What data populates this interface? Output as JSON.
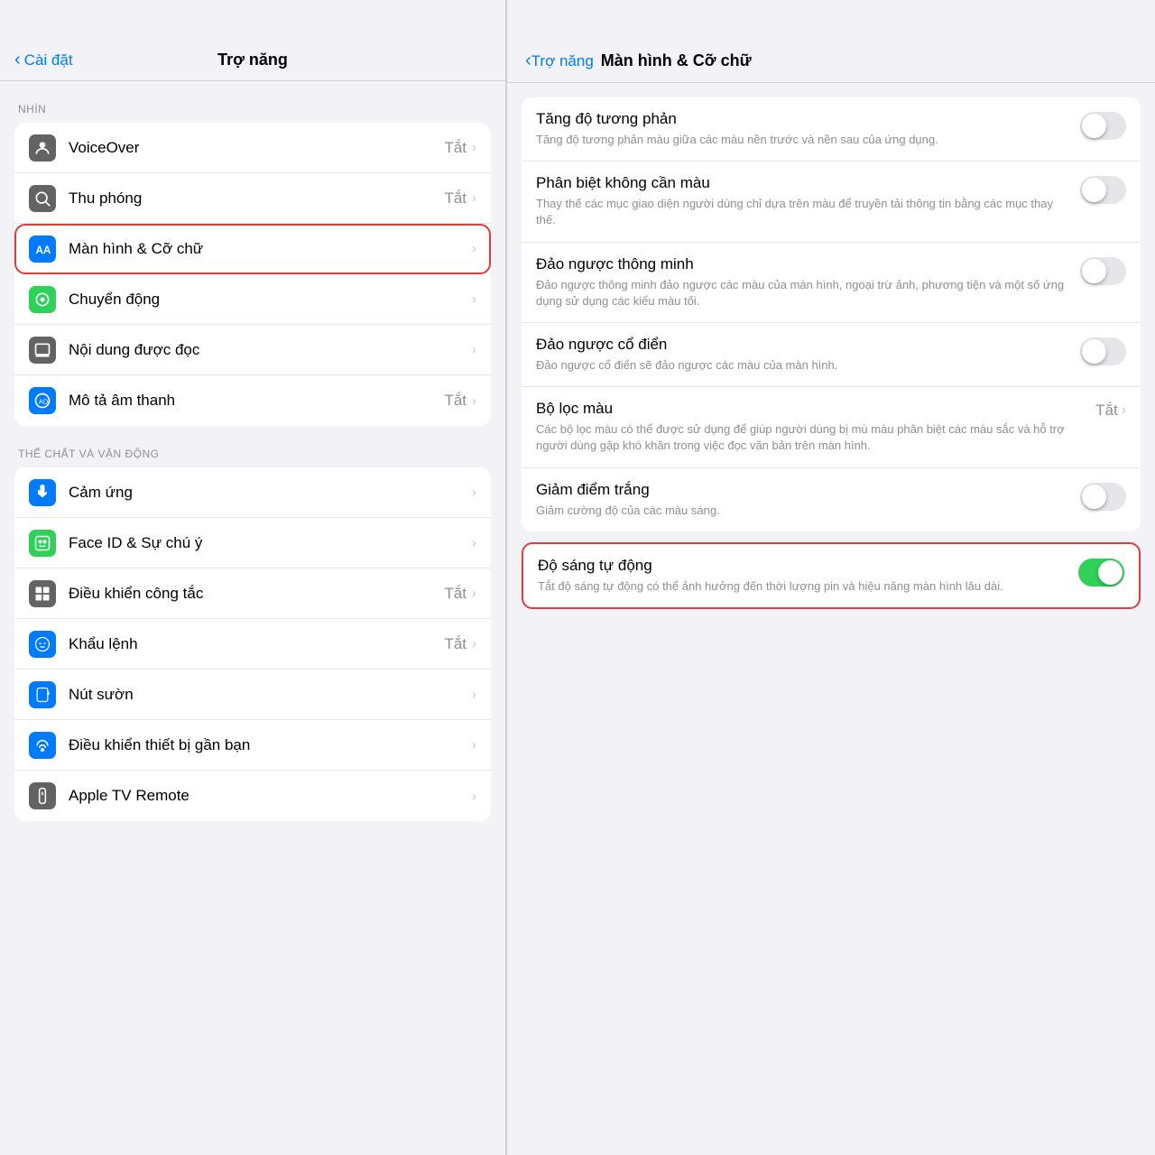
{
  "left": {
    "back_label": "Cài đặt",
    "title": "Trợ năng",
    "sections": [
      {
        "label": "NHÌN",
        "items": [
          {
            "id": "voiceover",
            "label": "VoiceOver",
            "value": "Tắt",
            "icon_bg": "icon-voiceover",
            "icon": "voiceover"
          },
          {
            "id": "zoom",
            "label": "Thu phóng",
            "value": "Tắt",
            "icon_bg": "icon-zoom",
            "icon": "zoom"
          },
          {
            "id": "display",
            "label": "Màn hình & Cỡ chữ",
            "value": "",
            "icon_bg": "icon-display",
            "icon": "display",
            "selected": true
          },
          {
            "id": "motion",
            "label": "Chuyển động",
            "value": "",
            "icon_bg": "icon-motion",
            "icon": "motion"
          },
          {
            "id": "spoken",
            "label": "Nội dung được đọc",
            "value": "",
            "icon_bg": "icon-spoken",
            "icon": "spoken"
          },
          {
            "id": "audiodesc",
            "label": "Mô tả âm thanh",
            "value": "Tắt",
            "icon_bg": "icon-audiodesc",
            "icon": "audiodesc"
          }
        ]
      },
      {
        "label": "THỂ CHẤT VÀ VẬN ĐỘNG",
        "items": [
          {
            "id": "touch",
            "label": "Cảm ứng",
            "value": "",
            "icon_bg": "icon-touch",
            "icon": "touch"
          },
          {
            "id": "faceid",
            "label": "Face ID & Sự chú ý",
            "value": "",
            "icon_bg": "icon-faceid",
            "icon": "faceid"
          },
          {
            "id": "switch",
            "label": "Điều khiển công tắc",
            "value": "Tắt",
            "icon_bg": "icon-switch",
            "icon": "switch"
          },
          {
            "id": "voice",
            "label": "Khẩu lệnh",
            "value": "Tắt",
            "icon_bg": "icon-voice",
            "icon": "voice"
          },
          {
            "id": "sidebutton",
            "label": "Nút sườn",
            "value": "",
            "icon_bg": "icon-sidebutton",
            "icon": "sidebutton"
          },
          {
            "id": "nearby",
            "label": "Điều khiển thiết bị gần bạn",
            "value": "",
            "icon_bg": "icon-nearby",
            "icon": "nearby"
          },
          {
            "id": "appletv",
            "label": "Apple TV Remote",
            "value": "",
            "icon_bg": "icon-appletv",
            "icon": "appletv"
          }
        ]
      }
    ]
  },
  "right": {
    "back_label": "Trợ năng",
    "title": "Màn hình & Cỡ chữ",
    "items": [
      {
        "id": "contrast",
        "title": "Tăng độ tương phản",
        "desc": "Tăng độ tương phản màu giữa các màu nền trước và nền sau của ứng dụng.",
        "control": "toggle_off"
      },
      {
        "id": "colorblind",
        "title": "Phân biệt không cần màu",
        "desc": "Thay thế các mục giao diện người dùng chỉ dựa trên màu để truyền tải thông tin bằng các mục thay thế.",
        "control": "toggle_off"
      },
      {
        "id": "smart_invert",
        "title": "Đảo ngược thông minh",
        "desc": "Đảo ngược thông minh đảo ngược các màu của màn hình, ngoại trừ ảnh, phương tiện và một số ứng dụng sử dụng các kiểu màu tối.",
        "control": "toggle_off"
      },
      {
        "id": "classic_invert",
        "title": "Đảo ngược cổ điển",
        "desc": "Đảo ngược cổ điển sẽ đảo ngược các màu của màn hình.",
        "control": "toggle_off"
      },
      {
        "id": "color_filter",
        "title": "Bộ lọc màu",
        "desc": "Các bộ lọc màu có thể được sử dụng để giúp người dùng bị mù màu phân biệt các màu sắc và hỗ trợ người dùng gặp khó khăn trong việc đọc văn bản trên màn hình.",
        "control": "value_tat"
      },
      {
        "id": "reduce_white",
        "title": "Giảm điểm trắng",
        "desc": "Giảm cường độ của các màu sáng.",
        "control": "toggle_off"
      },
      {
        "id": "auto_brightness",
        "title": "Độ sáng tự động",
        "desc": "Tắt độ sáng tự động có thể ảnh hưởng đến thời lượng pin và hiệu năng màn hình lâu dài.",
        "control": "toggle_on",
        "highlighted": true
      }
    ]
  }
}
